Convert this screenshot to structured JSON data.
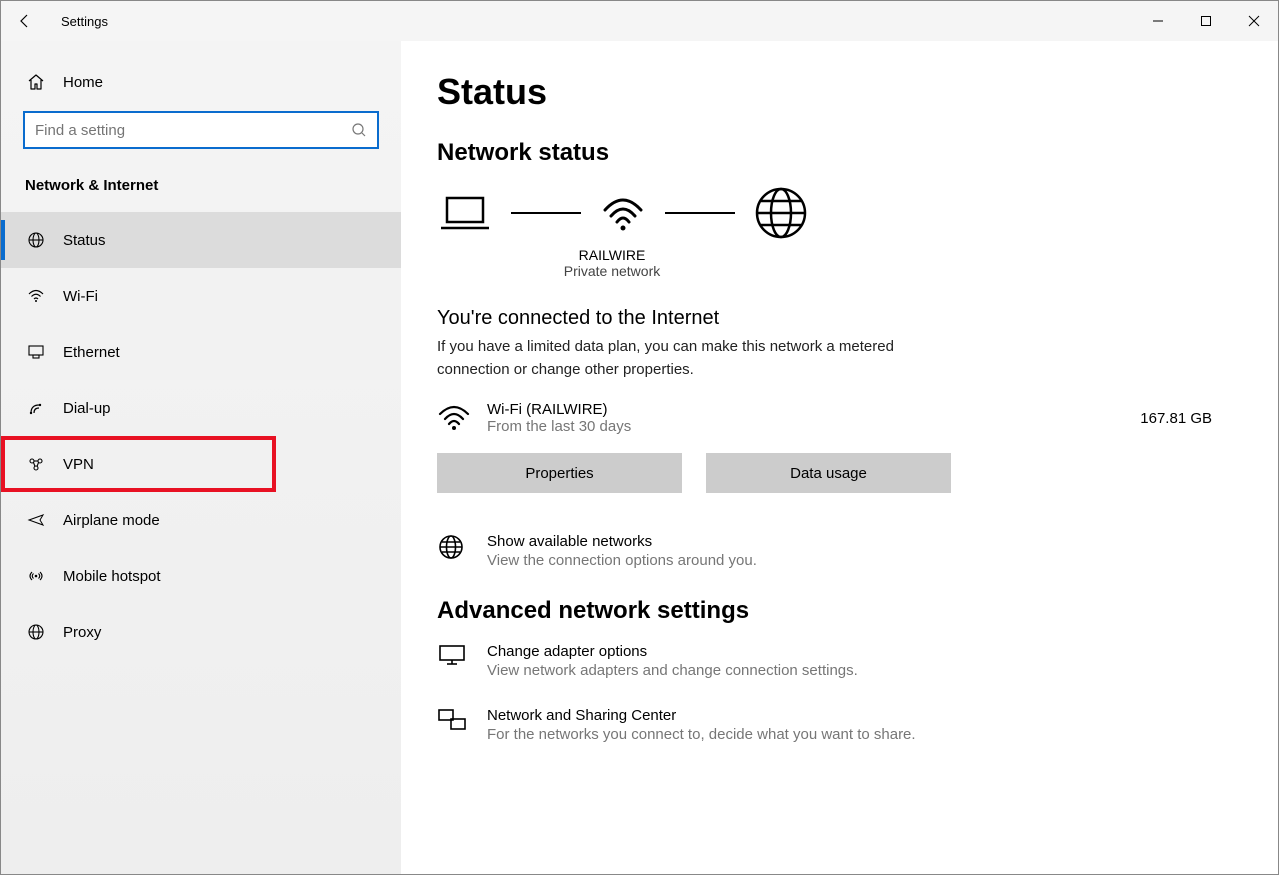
{
  "window": {
    "title": "Settings"
  },
  "sidebar": {
    "home": "Home",
    "search_placeholder": "Find a setting",
    "section": "Network & Internet",
    "items": [
      {
        "label": "Status"
      },
      {
        "label": "Wi-Fi"
      },
      {
        "label": "Ethernet"
      },
      {
        "label": "Dial-up"
      },
      {
        "label": "VPN"
      },
      {
        "label": "Airplane mode"
      },
      {
        "label": "Mobile hotspot"
      },
      {
        "label": "Proxy"
      }
    ]
  },
  "main": {
    "title": "Status",
    "section1": "Network status",
    "diagram": {
      "ssid": "RAILWIRE",
      "type": "Private network"
    },
    "connected_heading": "You're connected to the Internet",
    "connected_desc": "If you have a limited data plan, you can make this network a metered connection or change other properties.",
    "conn": {
      "name": "Wi-Fi (RAILWIRE)",
      "sub": "From the last 30 days",
      "usage": "167.81 GB"
    },
    "btn_properties": "Properties",
    "btn_datausage": "Data usage",
    "show_networks": {
      "title": "Show available networks",
      "sub": "View the connection options around you."
    },
    "section2": "Advanced network settings",
    "adapter": {
      "title": "Change adapter options",
      "sub": "View network adapters and change connection settings."
    },
    "sharing": {
      "title": "Network and Sharing Center",
      "sub": "For the networks you connect to, decide what you want to share."
    }
  }
}
